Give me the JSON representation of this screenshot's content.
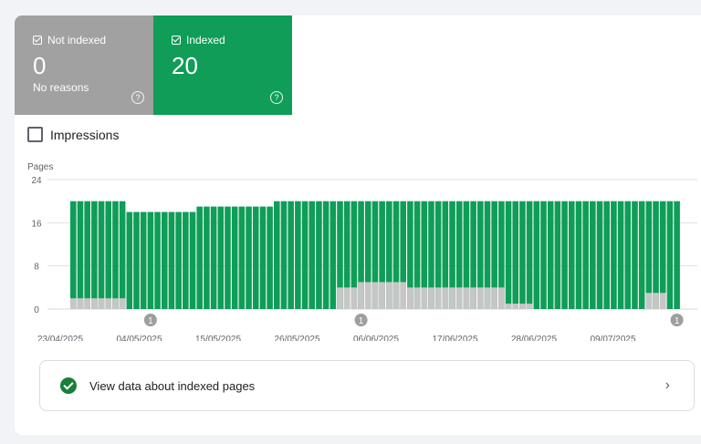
{
  "tiles": {
    "not_indexed": {
      "label": "Not indexed",
      "count": "0",
      "sub": "No reasons",
      "color": "#a1a1a1"
    },
    "indexed": {
      "label": "Indexed",
      "count": "20",
      "color": "#0f9d58"
    },
    "help_glyph": "?"
  },
  "impressions": {
    "label": "Impressions",
    "checked": false
  },
  "chart_data": {
    "type": "bar",
    "stacked": true,
    "ylabel": "Pages",
    "ylim": [
      0,
      24
    ],
    "yticks": [
      "0",
      "8",
      "16",
      "24"
    ],
    "xticks": [
      "23/04/2025",
      "04/05/2025",
      "15/05/2025",
      "26/05/2025",
      "06/06/2025",
      "17/06/2025",
      "28/06/2025",
      "09/07/2025"
    ],
    "annotation_glyph": "1",
    "annotations_at_bar_index": [
      11,
      41,
      86
    ],
    "indexed": [
      20,
      20,
      20,
      20,
      20,
      20,
      20,
      20,
      18,
      18,
      18,
      18,
      18,
      18,
      18,
      18,
      18,
      18,
      19,
      19,
      19,
      19,
      19,
      19,
      19,
      19,
      19,
      19,
      19,
      20,
      20,
      20,
      20,
      20,
      20,
      20,
      20,
      20,
      20,
      20,
      20,
      20,
      20,
      20,
      20,
      20,
      20,
      20,
      20,
      20,
      20,
      20,
      20,
      20,
      20,
      20,
      20,
      20,
      20,
      20,
      20,
      20,
      20,
      20,
      20,
      20,
      20,
      20,
      20,
      20,
      20,
      20,
      20,
      20,
      20,
      20,
      20,
      20,
      20,
      20,
      20,
      20,
      20,
      20,
      20,
      20,
      20
    ],
    "not_indexed": [
      2,
      2,
      2,
      2,
      2,
      2,
      2,
      2,
      0,
      0,
      0,
      0,
      0,
      0,
      0,
      0,
      0,
      0,
      0,
      0,
      0,
      0,
      0,
      0,
      0,
      0,
      0,
      0,
      0,
      0,
      0,
      0,
      0,
      0,
      0,
      0,
      0,
      0,
      4,
      4,
      4,
      5,
      5,
      5,
      5,
      5,
      5,
      5,
      4,
      4,
      4,
      4,
      4,
      4,
      4,
      4,
      4,
      4,
      4,
      4,
      4,
      4,
      1,
      1,
      1,
      1,
      0,
      0,
      0,
      0,
      0,
      0,
      0,
      0,
      0,
      0,
      0,
      0,
      0,
      0,
      0,
      0,
      3,
      3,
      3,
      0,
      0,
      0,
      0
    ],
    "colors": {
      "indexed": "#0f9d58",
      "not_indexed": "#c6c6c6",
      "grid": "#e0e0e0"
    },
    "grid": true
  },
  "link": {
    "label": "View data about indexed pages",
    "chevron": "›"
  }
}
